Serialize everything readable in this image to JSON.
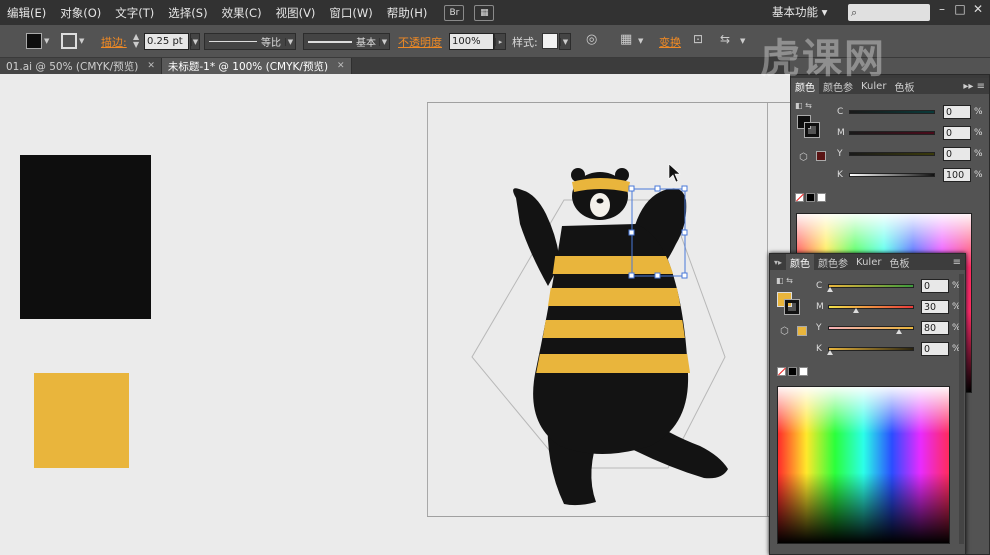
{
  "menu": {
    "items": [
      "编辑(E)",
      "对象(O)",
      "文字(T)",
      "选择(S)",
      "效果(C)",
      "视图(V)",
      "窗口(W)",
      "帮助(H)"
    ],
    "bridge_label": "Br",
    "workspace_label": "基本功能",
    "window_controls": [
      "–",
      "□",
      "✕"
    ]
  },
  "controlbar": {
    "stroke_label": "描边:",
    "stroke_value": "0.25 pt",
    "profile_label": "等比",
    "brush_label": "基本",
    "opacity_label": "不透明度",
    "opacity_value": "100%",
    "style_label": "样式:",
    "transform_label": "变换"
  },
  "tabs": [
    {
      "label": "01.ai @ 50% (CMYK/预览)",
      "close": "✕"
    },
    {
      "label": "未标题-1* @ 100% (CMYK/预览)",
      "close": "✕"
    }
  ],
  "watermark": "虎课网",
  "colors": {
    "black_swatch": "#0e0e0e",
    "yellow_swatch": "#e9b53c",
    "bear_black": "#131313",
    "bear_yellow": "#e9b53c",
    "selection": "#4a78d8"
  },
  "panel_back": {
    "tabs": [
      "颜色",
      "颜色参",
      "Kuler",
      "色板"
    ],
    "rows": [
      {
        "label": "C",
        "value": "0",
        "unit": "%"
      },
      {
        "label": "M",
        "value": "0",
        "unit": "%"
      },
      {
        "label": "Y",
        "value": "0",
        "unit": "%"
      },
      {
        "label": "K",
        "value": "100",
        "unit": "%"
      }
    ]
  },
  "panel_front": {
    "tabs": [
      "颜色",
      "颜色参",
      "Kuler",
      "色板"
    ],
    "rows": [
      {
        "label": "C",
        "value": "0",
        "unit": "%"
      },
      {
        "label": "M",
        "value": "30",
        "unit": "%"
      },
      {
        "label": "Y",
        "value": "80",
        "unit": "%"
      },
      {
        "label": "K",
        "value": "0",
        "unit": "%"
      }
    ]
  }
}
